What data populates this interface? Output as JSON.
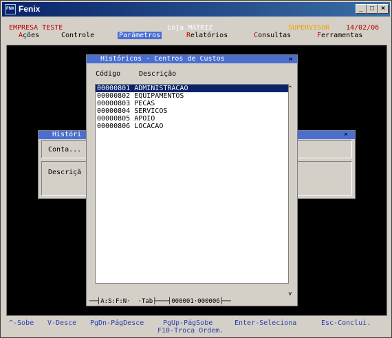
{
  "window": {
    "title": "Fenix",
    "icon_text": "FNX"
  },
  "header": {
    "empresa": "EMPRESA TESTE",
    "loja": "Loja MATRIZ",
    "usuario": "SUPERVISOR",
    "data": "14/02/06"
  },
  "menu": [
    {
      "hk": "A",
      "rest": "ções"
    },
    {
      "hk": "",
      "rest": "Controle"
    },
    {
      "hk": "",
      "rest": "Parâmetros"
    },
    {
      "hk": "R",
      "rest": "elatórios"
    },
    {
      "hk": "C",
      "rest": "onsultas"
    },
    {
      "hk": "F",
      "rest": "erramentas"
    }
  ],
  "bg_dialog": {
    "title": "Históri",
    "conta_label": "Conta...",
    "descricao_label": "Descriçã"
  },
  "dialog": {
    "title": "Históricos - Centros de Custos",
    "col_codigo": "Código",
    "col_descricao": "Descrição",
    "rows": [
      {
        "codigo": "00000801",
        "descricao": "ADMINISTRACAO"
      },
      {
        "codigo": "00000802",
        "descricao": "EQUIPAMENTOS"
      },
      {
        "codigo": "00000803",
        "descricao": "PECAS"
      },
      {
        "codigo": "00000804",
        "descricao": "SERVICOS"
      },
      {
        "codigo": "00000805",
        "descricao": "APOIO"
      },
      {
        "codigo": "00000806",
        "descricao": "LOCACAO"
      }
    ],
    "status_flags": "A:S:F:N·",
    "status_tab": "·Tab",
    "status_count": "000001·000006"
  },
  "footer": {
    "sobe": "^-Sobe",
    "desce": "V-Desce",
    "pgdn": "PgDn-PágDesce",
    "pgup": "PgUp-PágSobe",
    "enter": "Enter-Seleciona",
    "esc": "Esc-Conclui.",
    "f10": "F10-Troca Ordem."
  },
  "colors": {
    "title_bar": "#0a246a",
    "menu_active": "#4b6fd0",
    "header_red": "#c00000",
    "supervisor_orange": "#f0a000",
    "footer_blue": "#2b3fb0"
  }
}
